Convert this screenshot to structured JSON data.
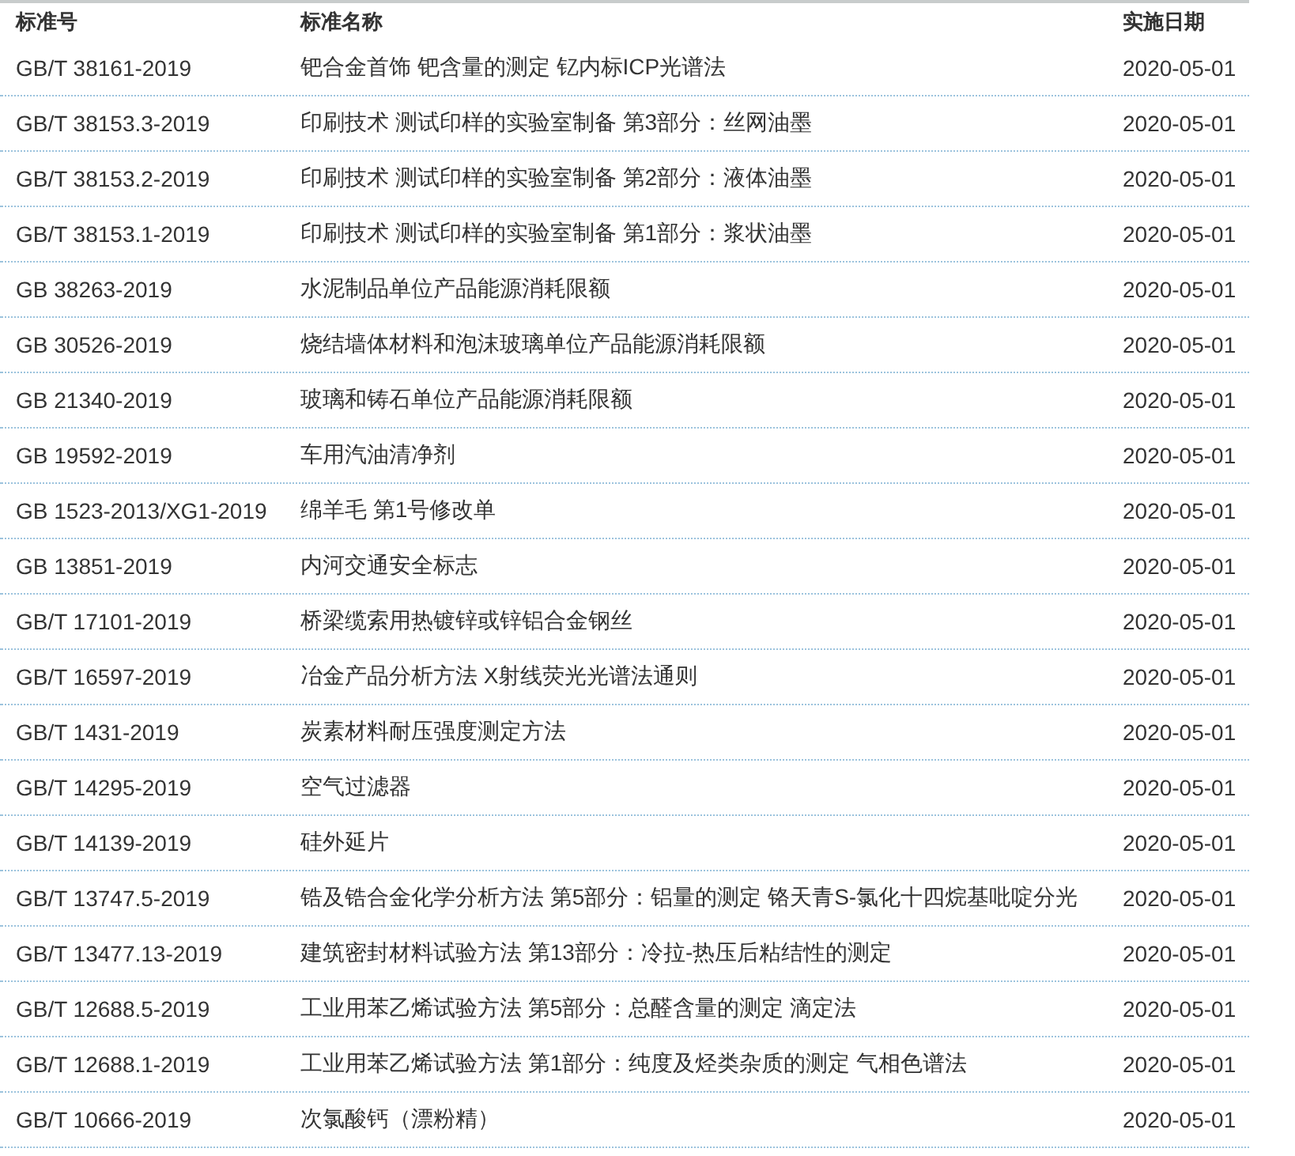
{
  "table": {
    "columns": [
      "标准号",
      "标准名称",
      "实施日期"
    ],
    "rows": [
      [
        "GB/T 38161-2019",
        "钯合金首饰 钯含量的测定 钇内标ICP光谱法",
        "2020-05-01"
      ],
      [
        "GB/T 38153.3-2019",
        "印刷技术 测试印样的实验室制备 第3部分：丝网油墨",
        "2020-05-01"
      ],
      [
        "GB/T 38153.2-2019",
        "印刷技术 测试印样的实验室制备 第2部分：液体油墨",
        "2020-05-01"
      ],
      [
        "GB/T 38153.1-2019",
        "印刷技术 测试印样的实验室制备 第1部分：浆状油墨",
        "2020-05-01"
      ],
      [
        "GB 38263-2019",
        "水泥制品单位产品能源消耗限额",
        "2020-05-01"
      ],
      [
        "GB 30526-2019",
        "烧结墙体材料和泡沫玻璃单位产品能源消耗限额",
        "2020-05-01"
      ],
      [
        "GB 21340-2019",
        "玻璃和铸石单位产品能源消耗限额",
        "2020-05-01"
      ],
      [
        "GB 19592-2019",
        "车用汽油清净剂",
        "2020-05-01"
      ],
      [
        "GB 1523-2013/XG1-2019",
        "绵羊毛 第1号修改单",
        "2020-05-01"
      ],
      [
        "GB 13851-2019",
        "内河交通安全标志",
        "2020-05-01"
      ],
      [
        "GB/T 17101-2019",
        "桥梁缆索用热镀锌或锌铝合金钢丝",
        "2020-05-01"
      ],
      [
        "GB/T 16597-2019",
        "冶金产品分析方法 X射线荧光光谱法通则",
        "2020-05-01"
      ],
      [
        "GB/T 1431-2019",
        "炭素材料耐压强度测定方法",
        "2020-05-01"
      ],
      [
        "GB/T 14295-2019",
        "空气过滤器",
        "2020-05-01"
      ],
      [
        "GB/T 14139-2019",
        "硅外延片",
        "2020-05-01"
      ],
      [
        "GB/T 13747.5-2019",
        "锆及锆合金化学分析方法 第5部分：铝量的测定 铬天青S-氯化十四烷基吡啶分光",
        "2020-05-01"
      ],
      [
        "GB/T 13477.13-2019",
        "建筑密封材料试验方法 第13部分：冷拉-热压后粘结性的测定",
        "2020-05-01"
      ],
      [
        "GB/T 12688.5-2019",
        "工业用苯乙烯试验方法 第5部分：总醛含量的测定 滴定法",
        "2020-05-01"
      ],
      [
        "GB/T 12688.1-2019",
        "工业用苯乙烯试验方法 第1部分：纯度及烃类杂质的测定 气相色谱法",
        "2020-05-01"
      ],
      [
        "GB/T 10666-2019",
        "次氯酸钙（漂粉精）",
        "2020-05-01"
      ]
    ]
  }
}
